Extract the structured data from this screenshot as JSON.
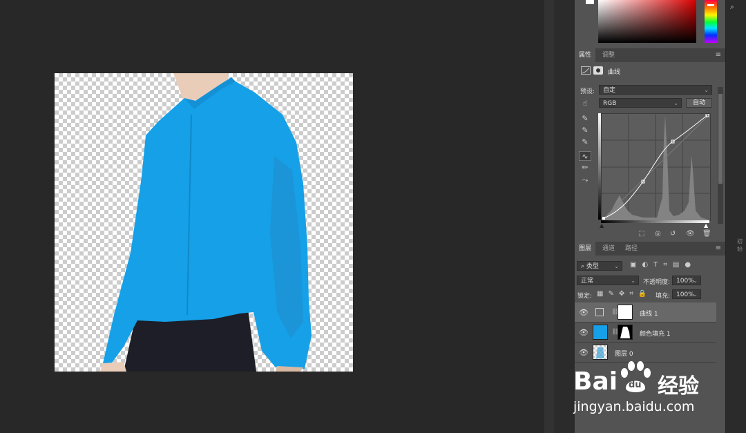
{
  "properties_panel": {
    "tabs": [
      "属性",
      "调整"
    ],
    "title": "曲线",
    "preset_label": "预设:",
    "preset_value": "自定",
    "channel_value": "RGB",
    "auto_label": "自动"
  },
  "layers_panel": {
    "tabs": [
      "图层",
      "通道",
      "路径"
    ],
    "filter_label": "类型",
    "blend_mode": "正常",
    "opacity_label": "不透明度:",
    "opacity_value": "100%",
    "lock_label": "锁定:",
    "fill_label": "填充:",
    "fill_value": "100%",
    "layers": [
      {
        "name": "曲线 1",
        "selected": true
      },
      {
        "name": "颜色填充 1",
        "selected": false
      },
      {
        "name": "图层 0",
        "selected": false
      }
    ]
  },
  "right_bar_text": "初始",
  "watermark": {
    "brand": "Bai",
    "paw": "du",
    "cn": "经验",
    "url": "jingyan.baidu.com"
  },
  "colors": {
    "shirt": "#15a0e8",
    "panel_bg": "#535353",
    "workspace_bg": "#282828"
  },
  "icons": [
    "search-icon",
    "panel-menu-icon",
    "curves-adjust-icon",
    "mask-icon",
    "hand-target-icon",
    "eyedropper-black-icon",
    "eyedropper-gray-icon",
    "eyedropper-white-icon",
    "curve-tool-icon",
    "pencil-icon",
    "smooth-icon",
    "clip-icon",
    "view-prev-icon",
    "reset-icon",
    "eye-icon",
    "trash-icon"
  ]
}
